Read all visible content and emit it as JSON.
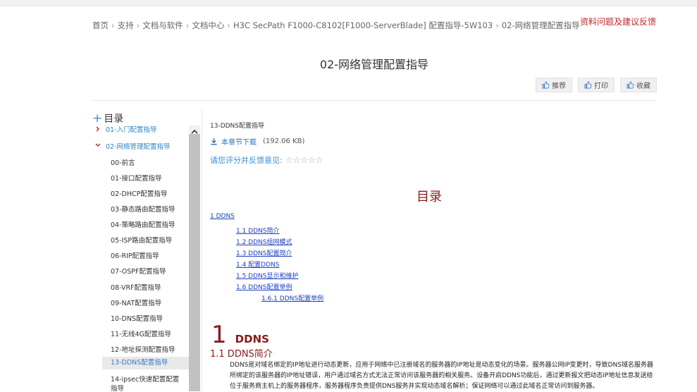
{
  "breadcrumb": {
    "items": [
      "首页",
      "支持",
      "文档与软件",
      "文档中心",
      "H3C SecPath F1000-C8102[F1000-ServerBlade] 配置指导-5W103",
      "02-网络管理配置指导"
    ]
  },
  "feedback_link": "资料问题及建议反馈",
  "page_title": "02-网络管理配置指导",
  "actions": {
    "recommend": "推荐",
    "print": "打印",
    "favorite": "收藏"
  },
  "toc": {
    "heading": "目录",
    "items": [
      {
        "label": "01-入门配置指导",
        "level": 1
      },
      {
        "label": "02-网络管理配置指导",
        "level": 1
      },
      {
        "label": "00-前言",
        "level": 2
      },
      {
        "label": "01-接口配置指导",
        "level": 2
      },
      {
        "label": "02-DHCP配置指导",
        "level": 2
      },
      {
        "label": "03-静态路由配置指导",
        "level": 2
      },
      {
        "label": "04-策略路由配置指导",
        "level": 2
      },
      {
        "label": "05-ISP路由配置指导",
        "level": 2
      },
      {
        "label": "06-RIP配置指导",
        "level": 2
      },
      {
        "label": "07-OSPF配置指导",
        "level": 2
      },
      {
        "label": "08-VRF配置指导",
        "level": 2
      },
      {
        "label": "09-NAT配置指导",
        "level": 2
      },
      {
        "label": "10-DNS配置指导",
        "level": 2
      },
      {
        "label": "11-无线4G配置指导",
        "level": 2
      },
      {
        "label": "12-地址探测配置指导",
        "level": 2
      },
      {
        "label": "13-DDNS配置指导",
        "level": 2
      },
      {
        "label": "14-ipsec快速配置配置指导",
        "level": 2
      }
    ]
  },
  "content": {
    "section_name": "13-DDNS配置指导",
    "download_label": "本章节下载",
    "download_size": "(192.06 KB)",
    "rating_label": "请您评分并反馈意见:",
    "rating_stars": 0,
    "doc_toc_title": "目录",
    "doc_toc": [
      {
        "label": "1 DDNS"
      },
      {
        "label": "1.1 DDNS简介"
      },
      {
        "label": "1.2 DDNS组网模式"
      },
      {
        "label": "1.3 DDNS配置简介"
      },
      {
        "label": "1.4 配置DDNS"
      },
      {
        "label": "1.5 DDNS显示和维护"
      },
      {
        "label": "1.6 DDNS配置举例"
      },
      {
        "label": "1.6.1 DDNS配置举例"
      }
    ],
    "h1_num": "1",
    "h1_text": "DDNS",
    "h2": "1.1  DDNS简介",
    "paragraph": "DDNS是对域名绑定的IP地址进行动态更新，应用于网络中已注册域名的服务器的IP地址是动态变化的场景。服务器公网IP变更时，导致DNS域名服务器所绑定的该服务器的IP地址错误，用户通过域名方式无法正常访问该服务器的相关服务。设备开启DDNS功能后，通过更新报文把动态IP地址信息发送给位于服务商主机上的服务器程序，服务器程序负责提供DNS服务并实现动态域名解析；保证网络可以通过此域名正常访问到服务器。"
  },
  "colors": {
    "accent_red": "#8b1a1a",
    "link_blue": "#1a3fc0",
    "feedback_red": "#c0282b"
  }
}
